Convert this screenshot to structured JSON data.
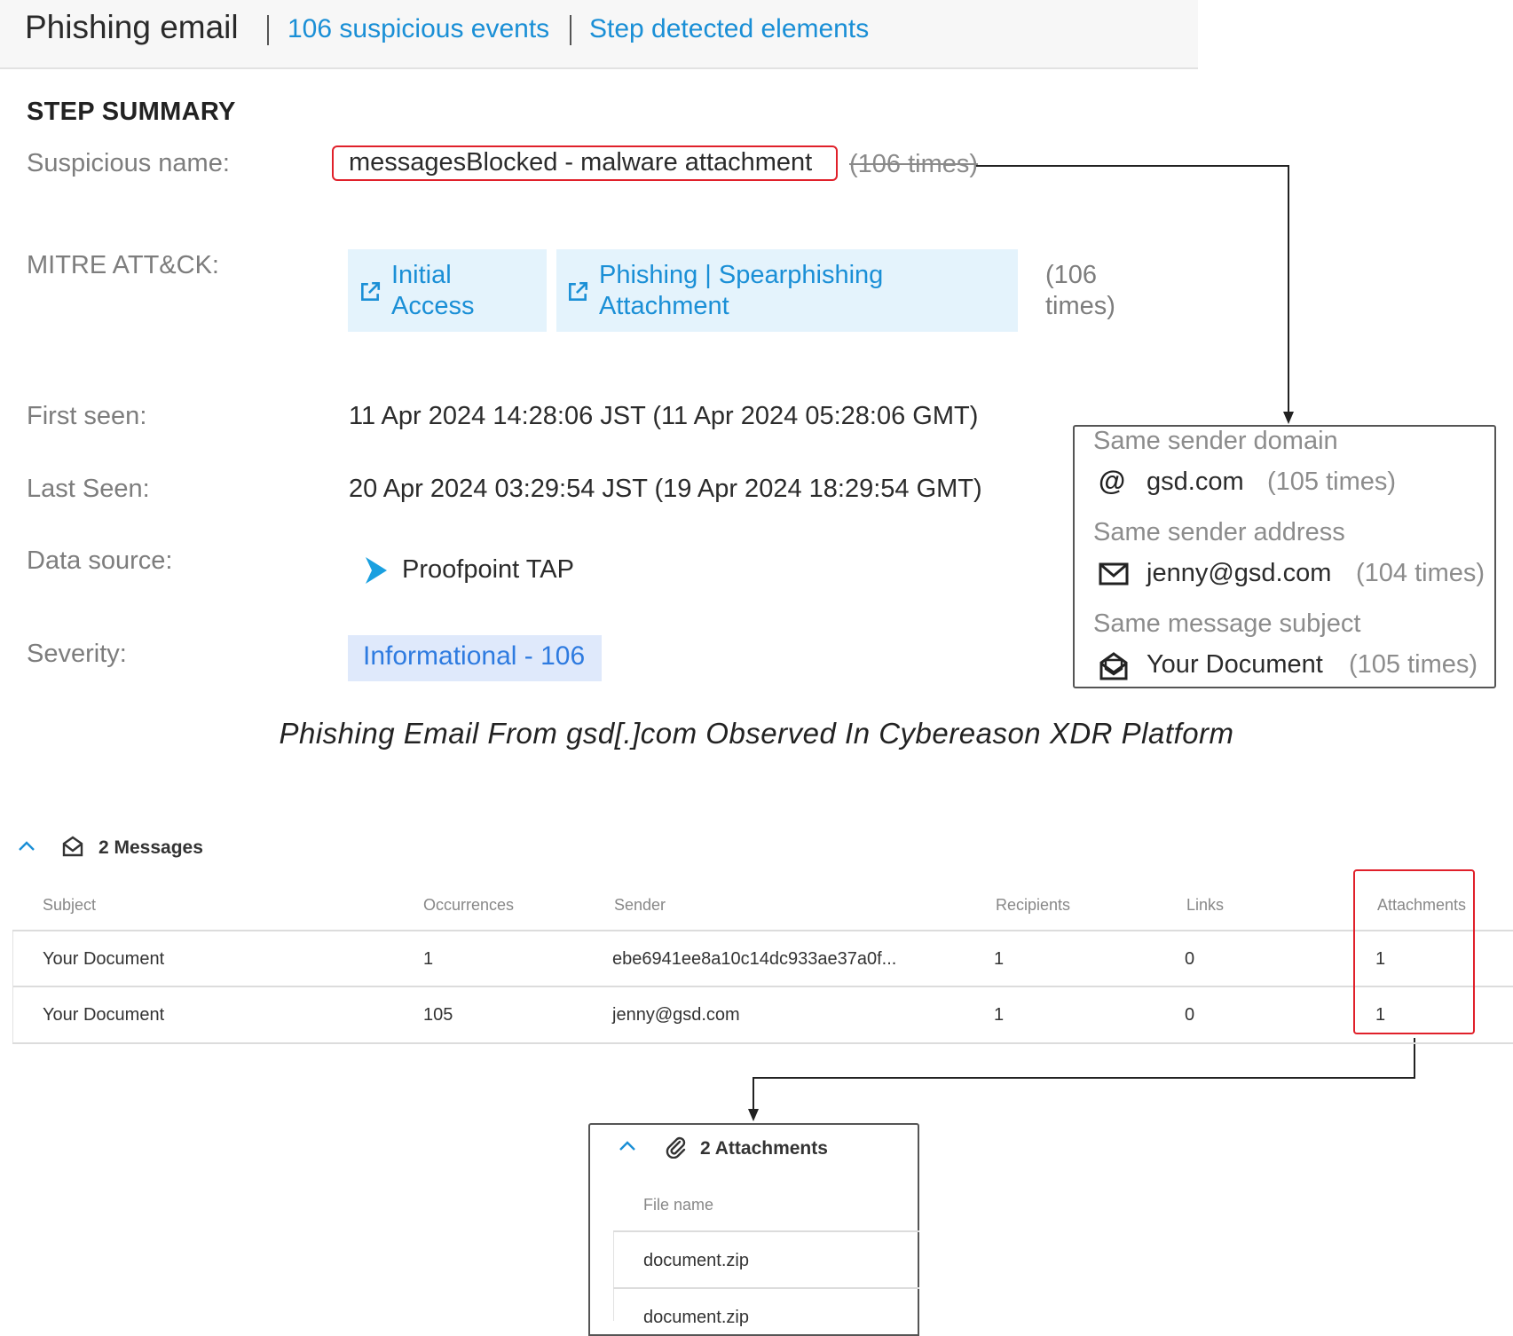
{
  "header": {
    "title": "Phishing email",
    "link_events": "106 suspicious events",
    "link_elements": "Step detected elements"
  },
  "summary": {
    "section_title": "STEP SUMMARY",
    "suspicious_name_label": "Suspicious name:",
    "suspicious_name_value": "messagesBlocked - malware attachment",
    "suspicious_name_times": "(106 times)",
    "mitre_label": "MITRE ATT&CK:",
    "mitre_tactic_line1": "Initial",
    "mitre_tactic_line2": "Access",
    "mitre_technique_line1": "Phishing | Spearphishing",
    "mitre_technique_line2": "Attachment",
    "mitre_times_line1": "(106",
    "mitre_times_line2": "times)",
    "first_seen_label": "First seen:",
    "first_seen_value": "11 Apr 2024 14:28:06 JST (11 Apr 2024 05:28:06 GMT)",
    "last_seen_label": "Last Seen:",
    "last_seen_value": "20 Apr 2024 03:29:54 JST (19 Apr 2024 18:29:54 GMT)",
    "data_source_label": "Data source:",
    "data_source_value": "Proofpoint TAP",
    "severity_label": "Severity:",
    "severity_value": "Informational - 106"
  },
  "popup": {
    "domain_heading": "Same sender domain",
    "domain_value": "gsd.com",
    "domain_times": "(105 times)",
    "address_heading": "Same sender address",
    "address_value": "jenny@gsd.com",
    "address_times": "(104 times)",
    "subject_heading": "Same message subject",
    "subject_value": "Your Document",
    "subject_times": "(105 times)"
  },
  "caption": "Phishing Email From gsd[.]com Observed In Cybereason XDR Platform",
  "messages": {
    "title": "2 Messages",
    "columns": [
      "Subject",
      "Occurrences",
      "Sender",
      "Recipients",
      "Links",
      "Attachments"
    ],
    "rows": [
      [
        "Your Document",
        "1",
        "ebe6941ee8a10c14dc933ae37a0f...",
        "1",
        "0",
        "1"
      ],
      [
        "Your Document",
        "105",
        "jenny@gsd.com",
        "1",
        "0",
        "1"
      ]
    ]
  },
  "attachments": {
    "title": "2 Attachments",
    "column": "File name",
    "rows": [
      "document.zip",
      "document.zip"
    ]
  },
  "colors": {
    "link_blue": "#1a8fd6",
    "highlight_red": "#e0202a",
    "chip_bg": "#e4f3fc",
    "severity_bg": "#dfe9fb"
  }
}
